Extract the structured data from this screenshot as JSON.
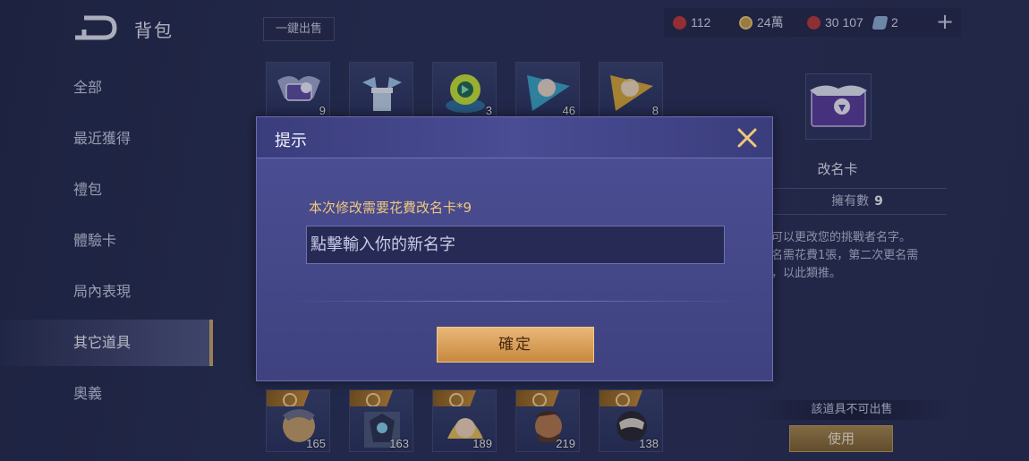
{
  "header": {
    "title": "背包",
    "back_icon": "back-arrow-icon"
  },
  "sidebar": {
    "items": [
      {
        "label": "全部"
      },
      {
        "label": "最近獲得"
      },
      {
        "label": "禮包"
      },
      {
        "label": "體驗卡"
      },
      {
        "label": "局內表現"
      },
      {
        "label": "其它道具"
      },
      {
        "label": "奧義"
      }
    ],
    "active_index": 5
  },
  "toolbar": {
    "sell_all_label": "一鍵出售"
  },
  "currencies": [
    {
      "icon": "ruby-icon",
      "value": "112",
      "color": "#c33a3a"
    },
    {
      "icon": "gold-coin-icon",
      "value": "24萬",
      "color": "#c9a04a"
    },
    {
      "icon": "red-gem-icon",
      "value": "30 107",
      "color": "#b83b3b"
    },
    {
      "icon": "ticket-icon",
      "value": "2",
      "color": "#8fb0d8"
    }
  ],
  "items_top": [
    {
      "icon": "rename-card-item-icon",
      "count": "9"
    },
    {
      "icon": "winged-box-item-icon",
      "count": ""
    },
    {
      "icon": "green-token-item-icon",
      "count": "3"
    },
    {
      "icon": "blue-hero-card-item-icon",
      "count": "46"
    },
    {
      "icon": "gold-hero-card-item-icon",
      "count": "8"
    }
  ],
  "items_bottom": [
    {
      "icon": "hero-portrait-item-icon",
      "count": "165"
    },
    {
      "icon": "hero-portrait-item-icon",
      "count": "163"
    },
    {
      "icon": "hero-portrait-item-icon",
      "count": "189"
    },
    {
      "icon": "hero-portrait-item-icon",
      "count": "219"
    },
    {
      "icon": "hero-portrait-item-icon",
      "count": "138"
    }
  ],
  "detail": {
    "name": "改名卡",
    "owned_label": "擁有數",
    "owned_count": "9",
    "desc_line1": "可以更改您的挑戰者名字。",
    "desc_line2": "名需花費1張，第二次更名需",
    "desc_line3": "，以此類推。",
    "not_sellable": "該道具不可出售",
    "use_label": "使用"
  },
  "dialog": {
    "title": "提示",
    "cost_text": "本次修改需要花費改名卡*9",
    "input_placeholder": "點擊輸入你的新名字",
    "input_value": "",
    "confirm_label": "確定"
  },
  "colors": {
    "accent_gold": "#c9a86a",
    "warning_text": "#f0c77b",
    "confirm_button": "#d9a35a"
  }
}
